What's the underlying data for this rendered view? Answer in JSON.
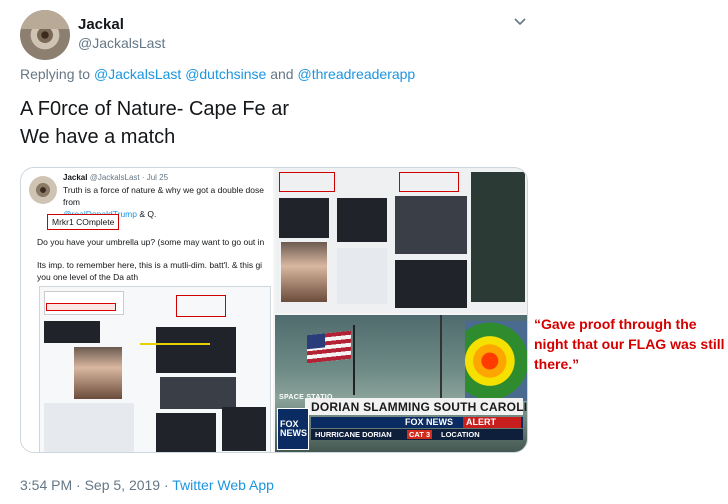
{
  "author": {
    "display_name": "Jackal",
    "handle": "@JackalsLast"
  },
  "reply_context": {
    "prefix": "Replying to",
    "mentions": [
      "@JackalsLast",
      "@dutchsinse",
      "and",
      "@threadreaderapp"
    ]
  },
  "tweet_text": {
    "line1": "A F0rce of Nature- Cape Fe ar",
    "line2": "We have a match"
  },
  "embedded_tweet": {
    "name": "Jackal",
    "handle_date": "@JackalsLast · Jul 25",
    "line1": "Truth is a force of nature & why we got a double dose from",
    "mention_line": "@realDonaldTrump",
    "mention_suffix": " & Q.",
    "marker_box": "Mrkr1 COmplete",
    "para1": "Do you have your umbrella up? (some may want to go out in",
    "para2": "Its imp. to remember here, this is a mutli-dim. batt'l. & this gi",
    "para3": "you one level of the Da ath"
  },
  "broadcast": {
    "headline": "DORIAN SLAMMING SOUTH CAROLINA COAST",
    "station_label": "SPACE STATIO",
    "logo_text": "FOX NEWS",
    "network_label": "FOX NEWS",
    "alert_label": "ALERT",
    "ticker": [
      "HURRICANE DORIAN",
      "CAT 3",
      "LOCATION"
    ]
  },
  "caption": {
    "text": "“Gave proof through the night that our FLAG was still there.”",
    "color": "#d40000"
  },
  "footer": {
    "time_date": "3:54 PM · Sep 5, 2019 · ",
    "app": "Twitter Web App"
  },
  "colors": {
    "link": "#1b95e0",
    "secondary_text": "#657786",
    "primary_text": "#14171a"
  },
  "icons": {
    "menu": "chevron-down-icon"
  }
}
